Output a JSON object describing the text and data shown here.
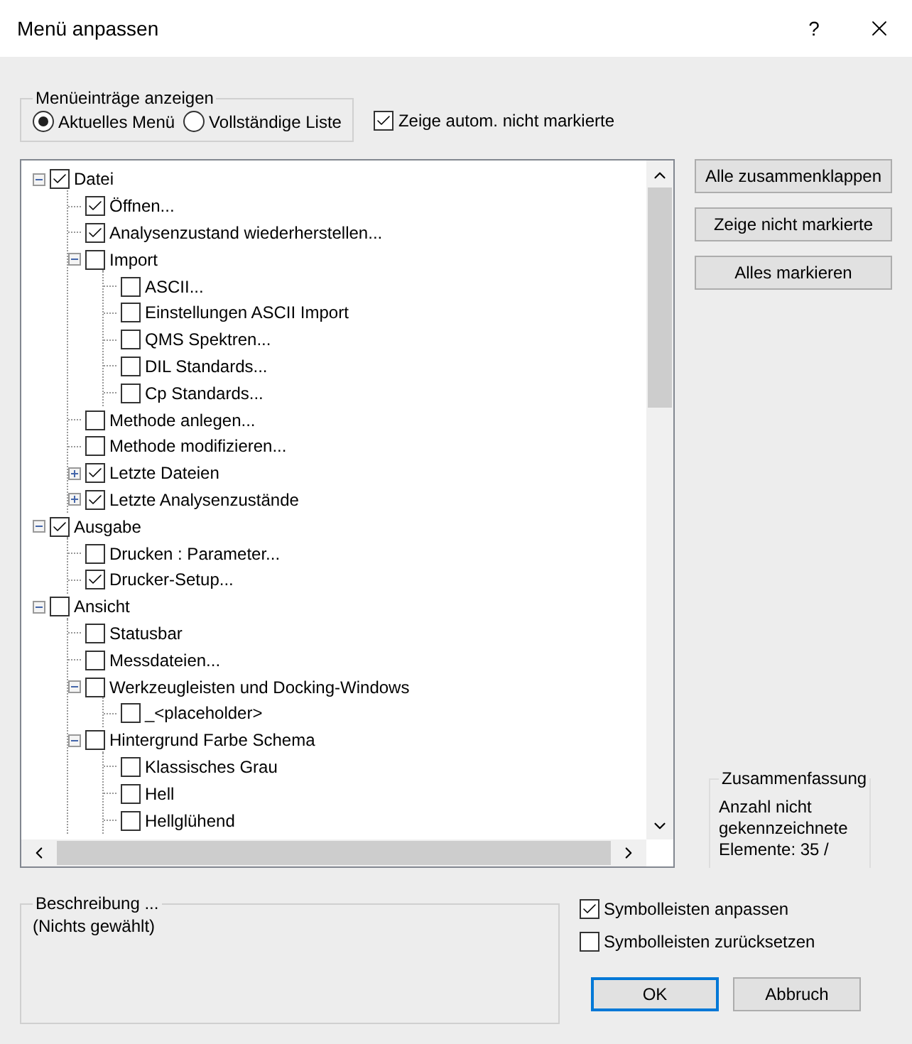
{
  "window": {
    "title": "Menü anpassen",
    "help": "?"
  },
  "display_group": {
    "title": "Menüeinträge anzeigen",
    "options": [
      {
        "label": "Aktuelles Menü",
        "selected": true
      },
      {
        "label": "Vollständige Liste",
        "selected": false
      }
    ]
  },
  "auto_checkbox": {
    "label": "Zeige autom. nicht markierte",
    "checked": true
  },
  "tree": [
    {
      "label": "Datei",
      "checked": true,
      "expanded": true,
      "children": [
        {
          "label": "Öffnen...",
          "checked": true
        },
        {
          "label": "Analysenzustand wiederherstellen...",
          "checked": true
        },
        {
          "label": "Import",
          "checked": false,
          "expanded": true,
          "children": [
            {
              "label": "ASCII...",
              "checked": false
            },
            {
              "label": "Einstellungen ASCII Import",
              "checked": false
            },
            {
              "label": "QMS Spektren...",
              "checked": false
            },
            {
              "label": "DIL Standards...",
              "checked": false
            },
            {
              "label": "Cp Standards...",
              "checked": false
            }
          ]
        },
        {
          "label": "Methode anlegen...",
          "checked": false
        },
        {
          "label": "Methode modifizieren...",
          "checked": false
        },
        {
          "label": "Letzte Dateien",
          "checked": true,
          "expanded": false
        },
        {
          "label": "Letzte Analysenzustände",
          "checked": true,
          "expanded": false
        }
      ]
    },
    {
      "label": "Ausgabe",
      "checked": true,
      "expanded": true,
      "children": [
        {
          "label": "Drucken : Parameter...",
          "checked": false
        },
        {
          "label": "Drucker-Setup...",
          "checked": true
        }
      ]
    },
    {
      "label": "Ansicht",
      "checked": false,
      "expanded": true,
      "children": [
        {
          "label": "Statusbar",
          "checked": false
        },
        {
          "label": "Messdateien...",
          "checked": false
        },
        {
          "label": "Werkzeugleisten und Docking-Windows",
          "checked": false,
          "expanded": true,
          "children": [
            {
              "label": "_<placeholder>",
              "checked": false
            }
          ]
        },
        {
          "label": "Hintergrund Farbe Schema",
          "checked": false,
          "expanded": true,
          "children": [
            {
              "label": "Klassisches Grau",
              "checked": false
            },
            {
              "label": "Hell",
              "checked": false
            },
            {
              "label": "Hellglühend",
              "checked": false
            }
          ]
        }
      ]
    }
  ],
  "buttons": [
    "Alle zusammenklappen",
    "Zeige nicht markierte",
    "Alles markieren"
  ],
  "summary": {
    "title": "Zusammenfassung",
    "text": "Anzahl nicht gekennzeichnete Elemente: 35 /"
  },
  "description": {
    "title": "Beschreibung ...",
    "text": "(Nichts gewählt)"
  },
  "toolbar_options": [
    {
      "label": "Symbolleisten anpassen",
      "checked": true
    },
    {
      "label": "Symbolleisten zurücksetzen",
      "checked": false
    }
  ],
  "ok": "OK",
  "cancel": "Abbruch"
}
